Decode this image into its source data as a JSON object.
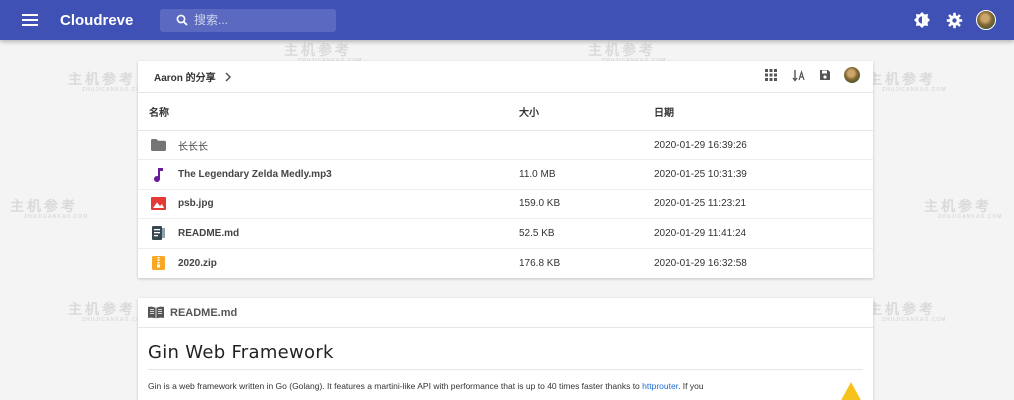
{
  "app": {
    "title": "Cloudreve"
  },
  "search": {
    "placeholder": "搜索..."
  },
  "breadcrumb": {
    "label": "Aaron 的分享"
  },
  "columns": {
    "name": "名称",
    "size": "大小",
    "date": "日期"
  },
  "files": [
    {
      "name": "长长长",
      "size": "",
      "date": "2020-01-29 16:39:26",
      "icon": "folder-icon"
    },
    {
      "name": "The Legendary Zelda Medly.mp3",
      "size": "11.0 MB",
      "date": "2020-01-25 10:31:39",
      "icon": "music-note-icon"
    },
    {
      "name": "psb.jpg",
      "size": "159.0 KB",
      "date": "2020-01-25 11:23:21",
      "icon": "image-icon"
    },
    {
      "name": "README.md",
      "size": "52.5 KB",
      "date": "2020-01-29 11:41:24",
      "icon": "markdown-file-icon"
    },
    {
      "name": "2020.zip",
      "size": "176.8 KB",
      "date": "2020-01-29 16:32:58",
      "icon": "archive-icon"
    }
  ],
  "readme": {
    "label": "README.md",
    "heading": "Gin Web Framework",
    "intro_text": "Gin is a web framework written in Go (Golang). It features a martini-like API with performance that is up to 40 times faster thanks to ",
    "intro_link": "httprouter",
    "intro_tail": ". If you"
  },
  "watermark": {
    "text": "主机参考",
    "subtext": "ZHUJICANKAO.COM"
  },
  "colors": {
    "appbar": "#3f51b5",
    "folder": "#757575",
    "music": "#6a1b9a",
    "image": "#e53935",
    "archive": "#f9a825",
    "link": "#1e6bd6"
  }
}
